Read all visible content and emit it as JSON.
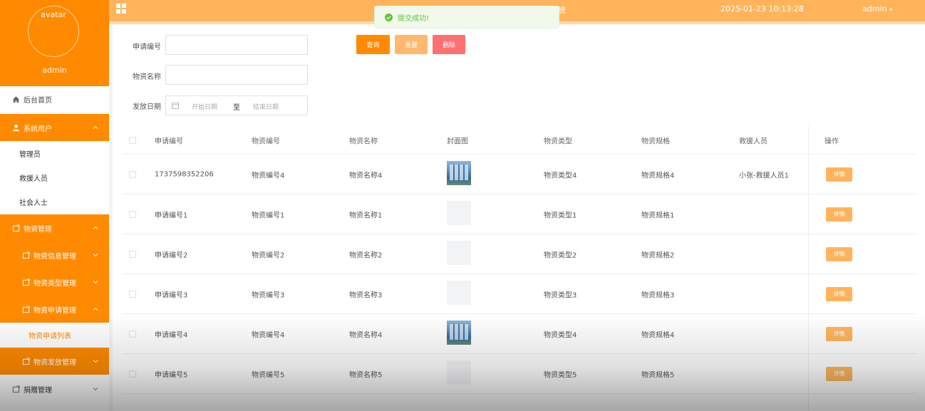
{
  "sidebar": {
    "avatar_text": "avatar",
    "username": "admin",
    "home": "后台首页",
    "system_users": "系统用户",
    "sub_users": [
      "管理员",
      "救援人员",
      "社会人士"
    ],
    "material_mgmt": "物资管理",
    "material_info": "物资信息管理",
    "material_type": "物资类型管理",
    "material_apply": "物资申请管理",
    "material_apply_list": "物资申请列表",
    "material_issue": "物资发放管理",
    "donation_mgmt": "捐赠管理"
  },
  "topbar": {
    "title": "统",
    "datetime": "2025-01-23 10:13:28",
    "user": "admin"
  },
  "toast": {
    "message": "提交成功!"
  },
  "filters": {
    "apply_no_label": "申请编号",
    "name_label": "物资名称",
    "date_label": "发放日期",
    "date_start": "开始日期",
    "date_sep": "至",
    "date_end": "结束日期",
    "search": "查询",
    "reset": "重置",
    "delete": "删除"
  },
  "table": {
    "headers": [
      "申请编号",
      "物资编号",
      "物资名称",
      "封面图",
      "物资类型",
      "物资规格",
      "救援人员",
      "操作"
    ],
    "detail_label": "详情",
    "rows": [
      {
        "apply_no": "1737598352206",
        "code": "物资编号4",
        "name": "物资名称4",
        "has_img": true,
        "type": "物资类型4",
        "spec": "物资规格4",
        "rescuer": "小张-救援人员1"
      },
      {
        "apply_no": "申请编号1",
        "code": "物资编号1",
        "name": "物资名称1",
        "has_img": false,
        "type": "物资类型1",
        "spec": "物资规格1",
        "rescuer": ""
      },
      {
        "apply_no": "申请编号2",
        "code": "物资编号2",
        "name": "物资名称2",
        "has_img": false,
        "type": "物资类型2",
        "spec": "物资规格2",
        "rescuer": ""
      },
      {
        "apply_no": "申请编号3",
        "code": "物资编号3",
        "name": "物资名称3",
        "has_img": false,
        "type": "物资类型3",
        "spec": "物资规格3",
        "rescuer": ""
      },
      {
        "apply_no": "申请编号4",
        "code": "物资编号4",
        "name": "物资名称4",
        "has_img": true,
        "type": "物资类型4",
        "spec": "物资规格4",
        "rescuer": ""
      },
      {
        "apply_no": "申请编号5",
        "code": "物资编号5",
        "name": "物资名称5",
        "has_img": false,
        "type": "物资类型5",
        "spec": "物资规格5",
        "rescuer": ""
      }
    ]
  },
  "colors": {
    "accent": "#ff8a00",
    "topbar": "#ffb45c",
    "success": "#67c23a"
  }
}
